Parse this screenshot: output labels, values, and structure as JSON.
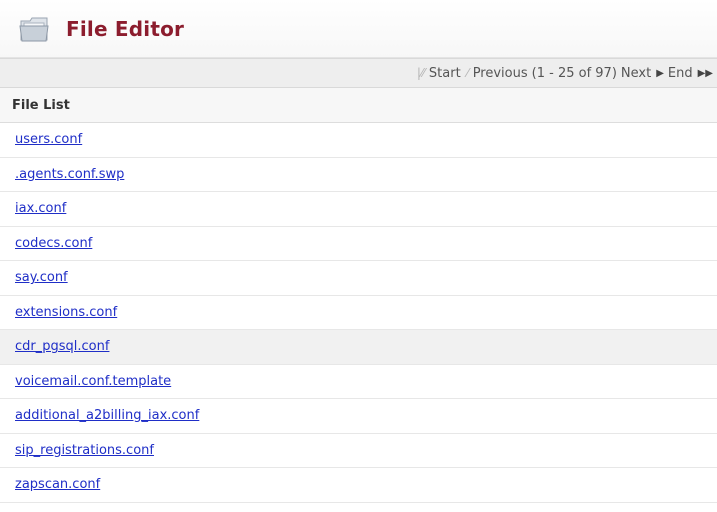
{
  "header": {
    "title": "File Editor",
    "icon": "folder-icon"
  },
  "pager": {
    "start_label": "Start",
    "previous_label": "Previous",
    "range_text": "(1 - 25 of 97)",
    "next_label": "Next",
    "end_label": "End"
  },
  "file_list": {
    "header": "File List",
    "files": [
      "users.conf",
      ".agents.conf.swp",
      "iax.conf",
      "codecs.conf",
      "say.conf",
      "extensions.conf",
      "cdr_pgsql.conf",
      "voicemail.conf.template",
      "additional_a2billing_iax.conf",
      "sip_registrations.conf",
      "zapscan.conf"
    ]
  },
  "colors": {
    "title": "#8c1d2e",
    "link": "#1f2ec7",
    "pager_bg": "#eeeeee",
    "highlight_row": "#f1f1f1"
  }
}
